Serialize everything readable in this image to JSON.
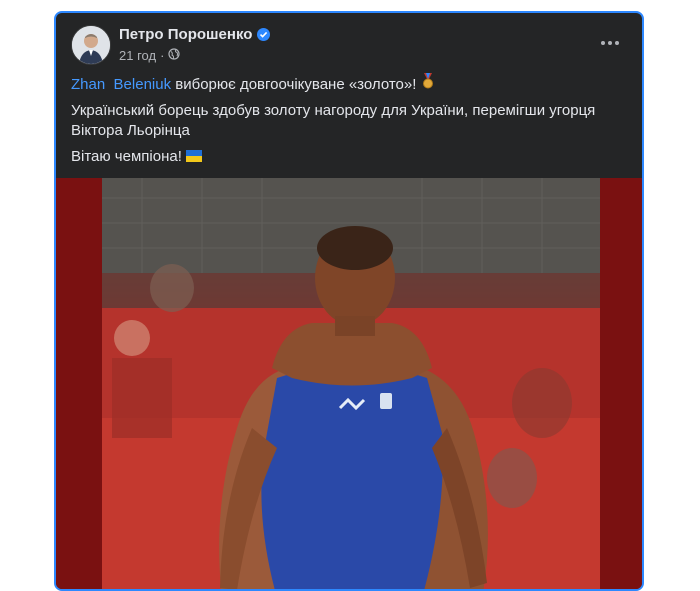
{
  "post": {
    "author": "Петро Порошенко",
    "time": "21 год",
    "separator": "·",
    "mention_first": "Zhan",
    "mention_last": "Beleniuk",
    "line1_rest": " виборює довгоочікуване «золото»! ",
    "medal_icon": "medal-icon",
    "line2": "Український борець здобув золоту нагороду для України, перемігши угорця Віктора Льорінца",
    "line3": "Вітаю чемпіона! ",
    "flag_icon": "ukraine-flag-icon"
  },
  "colors": {
    "card_bg": "#242526",
    "border": "#2d88ff",
    "link": "#4599ff",
    "media_bg": "#7a1111"
  }
}
